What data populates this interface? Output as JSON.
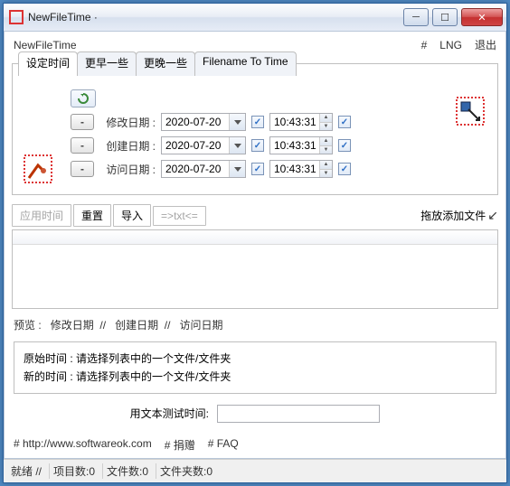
{
  "window": {
    "title": "NewFileTime ·"
  },
  "menubar": {
    "app": "NewFileTime",
    "hash": "#",
    "lng": "LNG",
    "exit": "退出"
  },
  "tabs": [
    "设定时间",
    "更早一些",
    "更晚一些",
    "Filename To Time"
  ],
  "rows": {
    "mod": {
      "label": "修改日期 :",
      "date": "2020-07-20",
      "time": "10:43:31"
    },
    "create": {
      "label": "创建日期 :",
      "date": "2020-07-20",
      "time": "10:43:31"
    },
    "access": {
      "label": "访问日期 :",
      "date": "2020-07-20",
      "time": "10:43:31"
    }
  },
  "toolbar": {
    "apply": "应用时间",
    "reset": "重置",
    "import": "导入",
    "txt": "=>txt<=",
    "drag": "拖放添加文件"
  },
  "preview": {
    "label": "预览 :",
    "c1": "修改日期",
    "c2": "创建日期",
    "c3": "访问日期",
    "sep": "//"
  },
  "info": {
    "origLabel": "原始时间 :",
    "origText": "请选择列表中的一个文件/文件夹",
    "newLabel": "新的时间 :",
    "newText": "请选择列表中的一个文件/文件夹"
  },
  "test": {
    "label": "用文本测试时间:",
    "value": ""
  },
  "footer": {
    "site": "# http://www.softwareok.com",
    "donate": "# 捐赠",
    "faq": "# FAQ"
  },
  "status": {
    "ready": "就绪 //",
    "items": "项目数:0",
    "files": "文件数:0",
    "folders": "文件夹数:0"
  }
}
